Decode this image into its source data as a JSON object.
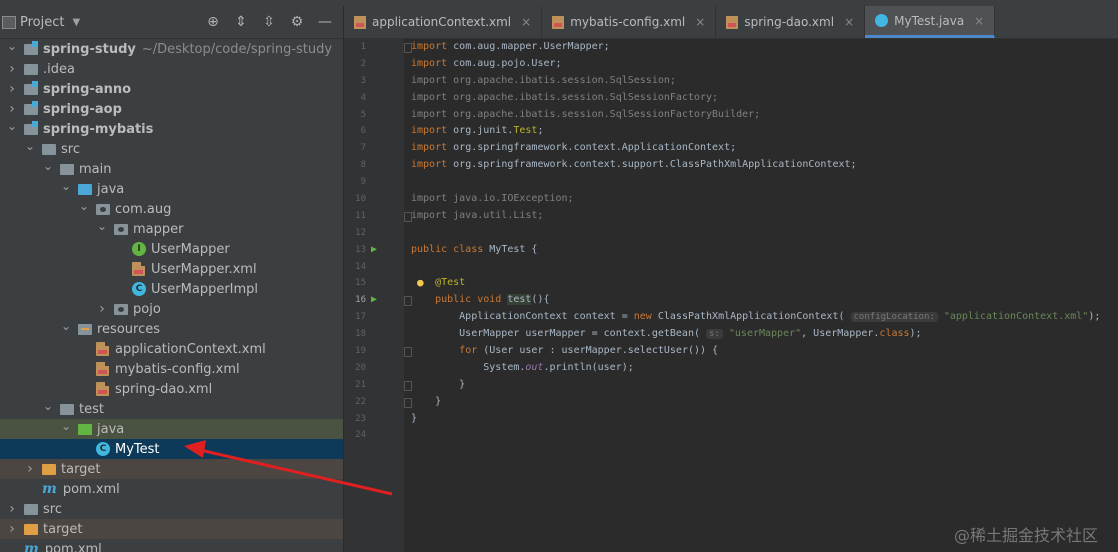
{
  "project_panel": {
    "title": "Project",
    "tree": [
      {
        "label": "spring-study",
        "suffix": "~/Desktop/code/spring-study",
        "depth": 0,
        "arrow": "down",
        "icon": "module-folder",
        "bold": true
      },
      {
        "label": ".idea",
        "depth": 0,
        "arrow": "right",
        "icon": "grey-folder"
      },
      {
        "label": "spring-anno",
        "depth": 0,
        "arrow": "right",
        "icon": "module-folder",
        "bold": true
      },
      {
        "label": "spring-aop",
        "depth": 0,
        "arrow": "right",
        "icon": "module-folder",
        "bold": true
      },
      {
        "label": "spring-mybatis",
        "depth": 0,
        "arrow": "down",
        "icon": "module-folder",
        "bold": true
      },
      {
        "label": "src",
        "depth": 1,
        "arrow": "down",
        "icon": "grey-folder"
      },
      {
        "label": "main",
        "depth": 2,
        "arrow": "down",
        "icon": "grey-folder"
      },
      {
        "label": "java",
        "depth": 3,
        "arrow": "down",
        "icon": "blue-folder"
      },
      {
        "label": "com.aug",
        "depth": 4,
        "arrow": "down",
        "icon": "package-folder"
      },
      {
        "label": "mapper",
        "depth": 5,
        "arrow": "down",
        "icon": "package-folder"
      },
      {
        "label": "UserMapper",
        "depth": 6,
        "arrow": "none",
        "icon": "interface-file"
      },
      {
        "label": "UserMapper.xml",
        "depth": 6,
        "arrow": "none",
        "icon": "xml-file"
      },
      {
        "label": "UserMapperImpl",
        "depth": 6,
        "arrow": "none",
        "icon": "class-file"
      },
      {
        "label": "pojo",
        "depth": 5,
        "arrow": "right",
        "icon": "package-folder"
      },
      {
        "label": "resources",
        "depth": 3,
        "arrow": "down",
        "icon": "resources-folder"
      },
      {
        "label": "applicationContext.xml",
        "depth": 4,
        "arrow": "none",
        "icon": "xml-file"
      },
      {
        "label": "mybatis-config.xml",
        "depth": 4,
        "arrow": "none",
        "icon": "xml-file"
      },
      {
        "label": "spring-dao.xml",
        "depth": 4,
        "arrow": "none",
        "icon": "xml-file"
      },
      {
        "label": "test",
        "depth": 2,
        "arrow": "down",
        "icon": "grey-folder"
      },
      {
        "label": "java",
        "depth": 3,
        "arrow": "down",
        "icon": "green-folder",
        "state": "sel-dim"
      },
      {
        "label": "MyTest",
        "depth": 4,
        "arrow": "none",
        "icon": "class-file",
        "state": "sel"
      },
      {
        "label": "target",
        "depth": 1,
        "arrow": "right",
        "icon": "orange-folder",
        "state": "excluded"
      },
      {
        "label": "pom.xml",
        "depth": 1,
        "arrow": "none",
        "icon": "maven-file"
      },
      {
        "label": "src",
        "depth": 0,
        "arrow": "right",
        "icon": "grey-folder"
      },
      {
        "label": "target",
        "depth": 0,
        "arrow": "right",
        "icon": "orange-folder",
        "state": "excluded"
      },
      {
        "label": "pom.xml",
        "depth": 0,
        "arrow": "none",
        "icon": "maven-file"
      }
    ]
  },
  "tabs": [
    {
      "label": "applicationContext.xml",
      "icon": "xml-file",
      "active": false
    },
    {
      "label": "mybatis-config.xml",
      "icon": "xml-file",
      "active": false
    },
    {
      "label": "spring-dao.xml",
      "icon": "xml-file",
      "active": false
    },
    {
      "label": "MyTest.java",
      "icon": "class-file",
      "active": true
    }
  ],
  "editor": {
    "current_line": 16,
    "lines": [
      [
        {
          "t": "import ",
          "c": "kw"
        },
        {
          "t": "com.aug.mapper.UserMapper;",
          "c": "pl"
        }
      ],
      [
        {
          "t": "import ",
          "c": "kw"
        },
        {
          "t": "com.aug.pojo.User;",
          "c": "pl"
        }
      ],
      [
        {
          "t": "import org.apache.ibatis.session.SqlSession;",
          "c": "gr"
        }
      ],
      [
        {
          "t": "import org.apache.ibatis.session.SqlSessionFactory;",
          "c": "gr"
        }
      ],
      [
        {
          "t": "import org.apache.ibatis.session.SqlSessionFactoryBuilder;",
          "c": "gr"
        }
      ],
      [
        {
          "t": "import ",
          "c": "kw"
        },
        {
          "t": "org.junit.",
          "c": "pl"
        },
        {
          "t": "Test",
          "c": "ann"
        },
        {
          "t": ";",
          "c": "pl"
        }
      ],
      [
        {
          "t": "import ",
          "c": "kw"
        },
        {
          "t": "org.springframework.context.ApplicationContext;",
          "c": "pl"
        }
      ],
      [
        {
          "t": "import ",
          "c": "kw"
        },
        {
          "t": "org.springframework.context.support.ClassPathXmlApplicationContext;",
          "c": "pl"
        }
      ],
      [],
      [
        {
          "t": "import java.io.IOException;",
          "c": "gr"
        }
      ],
      [
        {
          "t": "import java.util.List;",
          "c": "gr"
        }
      ],
      [],
      [
        {
          "t": "public class ",
          "c": "kw"
        },
        {
          "t": "MyTest {",
          "c": "pl"
        }
      ],
      [],
      [
        {
          "t": "    ",
          "c": "pl"
        },
        {
          "t": "@Test",
          "c": "ann"
        }
      ],
      [
        {
          "t": "    public void ",
          "c": "kw"
        },
        {
          "t": "test",
          "c": "pl",
          "h": true
        },
        {
          "t": "(){",
          "c": "pl"
        }
      ],
      [
        {
          "t": "        ApplicationContext context = ",
          "c": "pl"
        },
        {
          "t": "new ",
          "c": "kw"
        },
        {
          "t": "ClassPathXmlApplicationContext( ",
          "c": "pl"
        },
        {
          "t": "configLocation:",
          "c": "hint"
        },
        {
          "t": " ",
          "c": "pl"
        },
        {
          "t": "\"applicationContext.xml\"",
          "c": "str"
        },
        {
          "t": ");",
          "c": "pl"
        }
      ],
      [
        {
          "t": "        UserMapper userMapper = context.getBean( ",
          "c": "pl"
        },
        {
          "t": "s:",
          "c": "hint"
        },
        {
          "t": " ",
          "c": "pl"
        },
        {
          "t": "\"userMapper\"",
          "c": "str"
        },
        {
          "t": ", UserMapper.",
          "c": "pl"
        },
        {
          "t": "class",
          "c": "kw"
        },
        {
          "t": ");",
          "c": "pl"
        }
      ],
      [
        {
          "t": "        ",
          "c": "pl"
        },
        {
          "t": "for ",
          "c": "kw"
        },
        {
          "t": "(User user : userMapper.selectUser()) {",
          "c": "pl"
        }
      ],
      [
        {
          "t": "            System.",
          "c": "pl"
        },
        {
          "t": "out",
          "c": "fld"
        },
        {
          "t": ".println(user);",
          "c": "pl"
        }
      ],
      [
        {
          "t": "        }",
          "c": "pl"
        }
      ],
      [
        {
          "t": "    }",
          "c": "pl"
        }
      ],
      [
        {
          "t": "}",
          "c": "pl"
        }
      ],
      []
    ]
  },
  "watermark": "@稀土掘金技术社区"
}
